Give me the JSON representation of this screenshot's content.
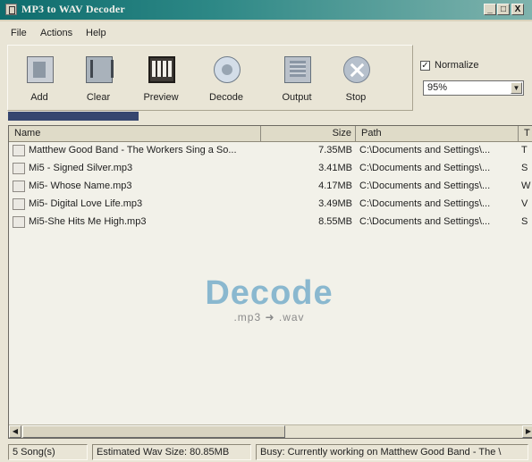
{
  "window": {
    "title": "MP3 to WAV Decoder"
  },
  "window_buttons": [
    "_",
    "□",
    "X"
  ],
  "menu": [
    "File",
    "Actions",
    "Help"
  ],
  "toolbar": [
    {
      "label": "Add",
      "icon": "add-files-icon"
    },
    {
      "label": "Clear",
      "icon": "clear-icon"
    },
    {
      "label": "Preview",
      "icon": "preview-icon"
    },
    {
      "label": "Decode",
      "icon": "decode-icon"
    },
    {
      "label": "Output",
      "icon": "output-folder-icon"
    },
    {
      "label": "Stop",
      "icon": "stop-icon"
    }
  ],
  "normalize": {
    "label": "Normalize",
    "checked": true,
    "value": "95%"
  },
  "progress": {
    "value": 0.26
  },
  "list": {
    "columns": [
      "Name",
      "Size",
      "Path",
      "T"
    ],
    "rows": [
      {
        "name": "Matthew Good Band - The Workers Sing a So...",
        "size": "7.35MB",
        "path": "C:\\Documents and Settings\\...",
        "t": "T"
      },
      {
        "name": "Mi5 - Signed Silver.mp3",
        "size": "3.41MB",
        "path": "C:\\Documents and Settings\\...",
        "t": "S"
      },
      {
        "name": "Mi5- Whose Name.mp3",
        "size": "4.17MB",
        "path": "C:\\Documents and Settings\\...",
        "t": "W"
      },
      {
        "name": "Mi5- Digital Love Life.mp3",
        "size": "3.49MB",
        "path": "C:\\Documents and Settings\\...",
        "t": "V"
      },
      {
        "name": "Mi5-She Hits Me High.mp3",
        "size": "8.55MB",
        "path": "C:\\Documents and Settings\\...",
        "t": "S"
      }
    ]
  },
  "watermark": {
    "title": "Decode",
    "subtitle": ".mp3 ➜ .wav"
  },
  "status": {
    "songs": "5 Song(s)",
    "wav_size": "Estimated Wav Size: 80.85MB",
    "busy": "Busy: Currently working on Matthew Good Band - The \\"
  }
}
